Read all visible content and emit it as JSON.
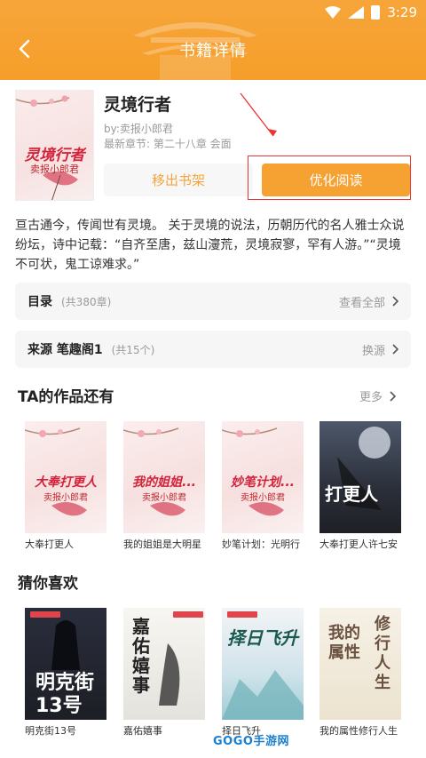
{
  "status_bar": {
    "time": "3:29"
  },
  "header": {
    "title": "书籍详情"
  },
  "book": {
    "title": "灵境行者",
    "author": "by:卖报小郎君",
    "latest_chapter": "最新章节: 第二十八章 会面",
    "cover_title": "灵境行者",
    "cover_author": "卖报小郎君",
    "remove_label": "移出书架",
    "read_label": "优化阅读",
    "description": "亘古通今，传闻世有灵境。 关于灵境的说法，历朝历代的名人雅士众说纷坛，诗中记载：“自齐至唐，兹山濅荒，灵境寂寥，罕有人游。”“灵境不可状，鬼工谅难求。”"
  },
  "catalog": {
    "label": "目录",
    "count": "(共380章)",
    "action": "查看全部"
  },
  "source": {
    "label": "来源 笔趣阁1",
    "count": "(共15个)",
    "action": "换源"
  },
  "works": {
    "title": "TA的作品还有",
    "more": "更多",
    "items": [
      {
        "name": "大奉打更人",
        "cover_title": "大奉打更人",
        "cover_author": "卖报小郎君"
      },
      {
        "name": "我的姐姐是大明星",
        "cover_title": "我的姐姐...",
        "cover_author": "卖报小郎君"
      },
      {
        "name": "妙笔计划：光明行",
        "cover_title": "妙笔计划...",
        "cover_author": "卖报小郎君"
      },
      {
        "name": "大奉打更人许七安",
        "cover_title": "打更人"
      }
    ]
  },
  "guess": {
    "title": "猜你喜欢",
    "items": [
      {
        "name": "明克街13号",
        "cover_title": "明克街13号"
      },
      {
        "name": "嘉佑嬉事",
        "cover_title": "嘉佑嬉事"
      },
      {
        "name": "择日飞升",
        "cover_title": "择日飞升"
      },
      {
        "name": "我的属性修行人生",
        "cover_title": "我的属性",
        "cover_title2": "修行人生"
      }
    ]
  },
  "watermark": "GOGO手游网"
}
